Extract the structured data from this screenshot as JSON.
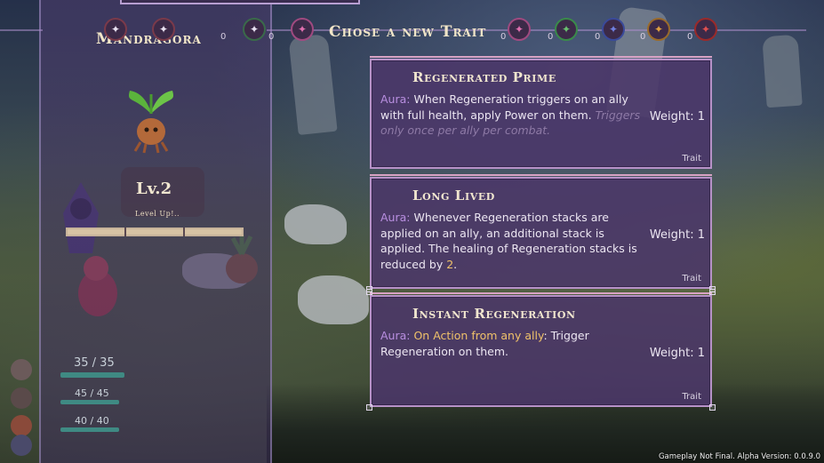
{
  "character": {
    "name": "Mandragora",
    "level": "Lv.2",
    "level_up": "Level Up!..",
    "xp_fraction": 1.0
  },
  "party": [
    {
      "hp": "35 / 35",
      "hp_fraction": 1.0,
      "color": "#6b5a5a"
    },
    {
      "hp": "45 / 45",
      "hp_fraction": 1.0,
      "color": "#8a4a3a"
    },
    {
      "hp": "40 / 40",
      "hp_fraction": 1.0,
      "color": "#4a4a6a"
    }
  ],
  "header": {
    "title": "Chose a new Trait",
    "left_gem_counts": [
      "0",
      "0"
    ],
    "gem_counts": [
      "0",
      "0",
      "0",
      "0",
      "0",
      "0"
    ]
  },
  "traits": [
    {
      "title": "Regenerated Prime",
      "aura_label": "Aura:",
      "desc_main": "When Regeneration triggers on an ally with full health, apply Power on them.",
      "desc_faded": "Triggers only once per ally per combat.",
      "weight": "Weight: 1",
      "tag": "Trait"
    },
    {
      "title": "Long Lived",
      "aura_label": "Aura:",
      "desc_main": "Whenever Regeneration stacks are applied on an ally, an additional stack is applied. The healing of Regeneration stacks is reduced by",
      "desc_number": "2",
      "desc_end": ".",
      "weight": "Weight: 1",
      "tag": "Trait"
    },
    {
      "title": "Instant Regeneration",
      "aura_label": "Aura:",
      "desc_trigger": "On Action from any ally",
      "desc_main": ": Trigger Regeneration on them.",
      "weight": "Weight: 1",
      "tag": "Trait"
    }
  ],
  "footer": {
    "version": "Gameplay Not Final. Alpha Version: 0.0.9.0"
  },
  "colors": {
    "aura": "#b88ee0",
    "highlight": "#f0c26a",
    "card_border": "#b792c8"
  }
}
